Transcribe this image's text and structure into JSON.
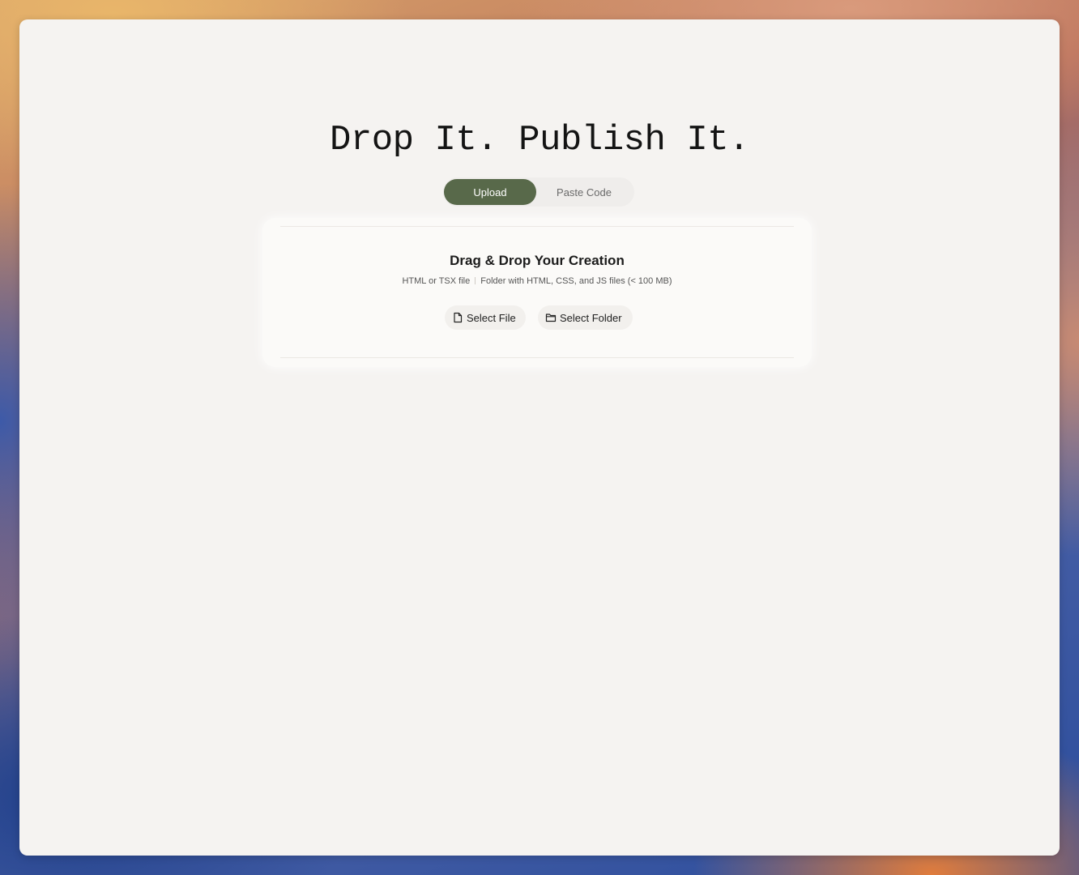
{
  "hero": {
    "title": "Drop It. Publish It."
  },
  "tabs": [
    {
      "label": "Upload",
      "active": true
    },
    {
      "label": "Paste Code",
      "active": false
    }
  ],
  "drop_zone": {
    "title": "Drag & Drop Your Creation",
    "subtitle_file": "HTML or TSX file",
    "subtitle_folder": "Folder with HTML, CSS, and JS files (< 100 MB)",
    "select_file_label": "Select File",
    "select_folder_label": "Select Folder",
    "file_icon": "file-icon",
    "folder_icon": "folder-icon"
  },
  "colors": {
    "accent": "#58694a",
    "window_bg": "#f5f3f1"
  }
}
